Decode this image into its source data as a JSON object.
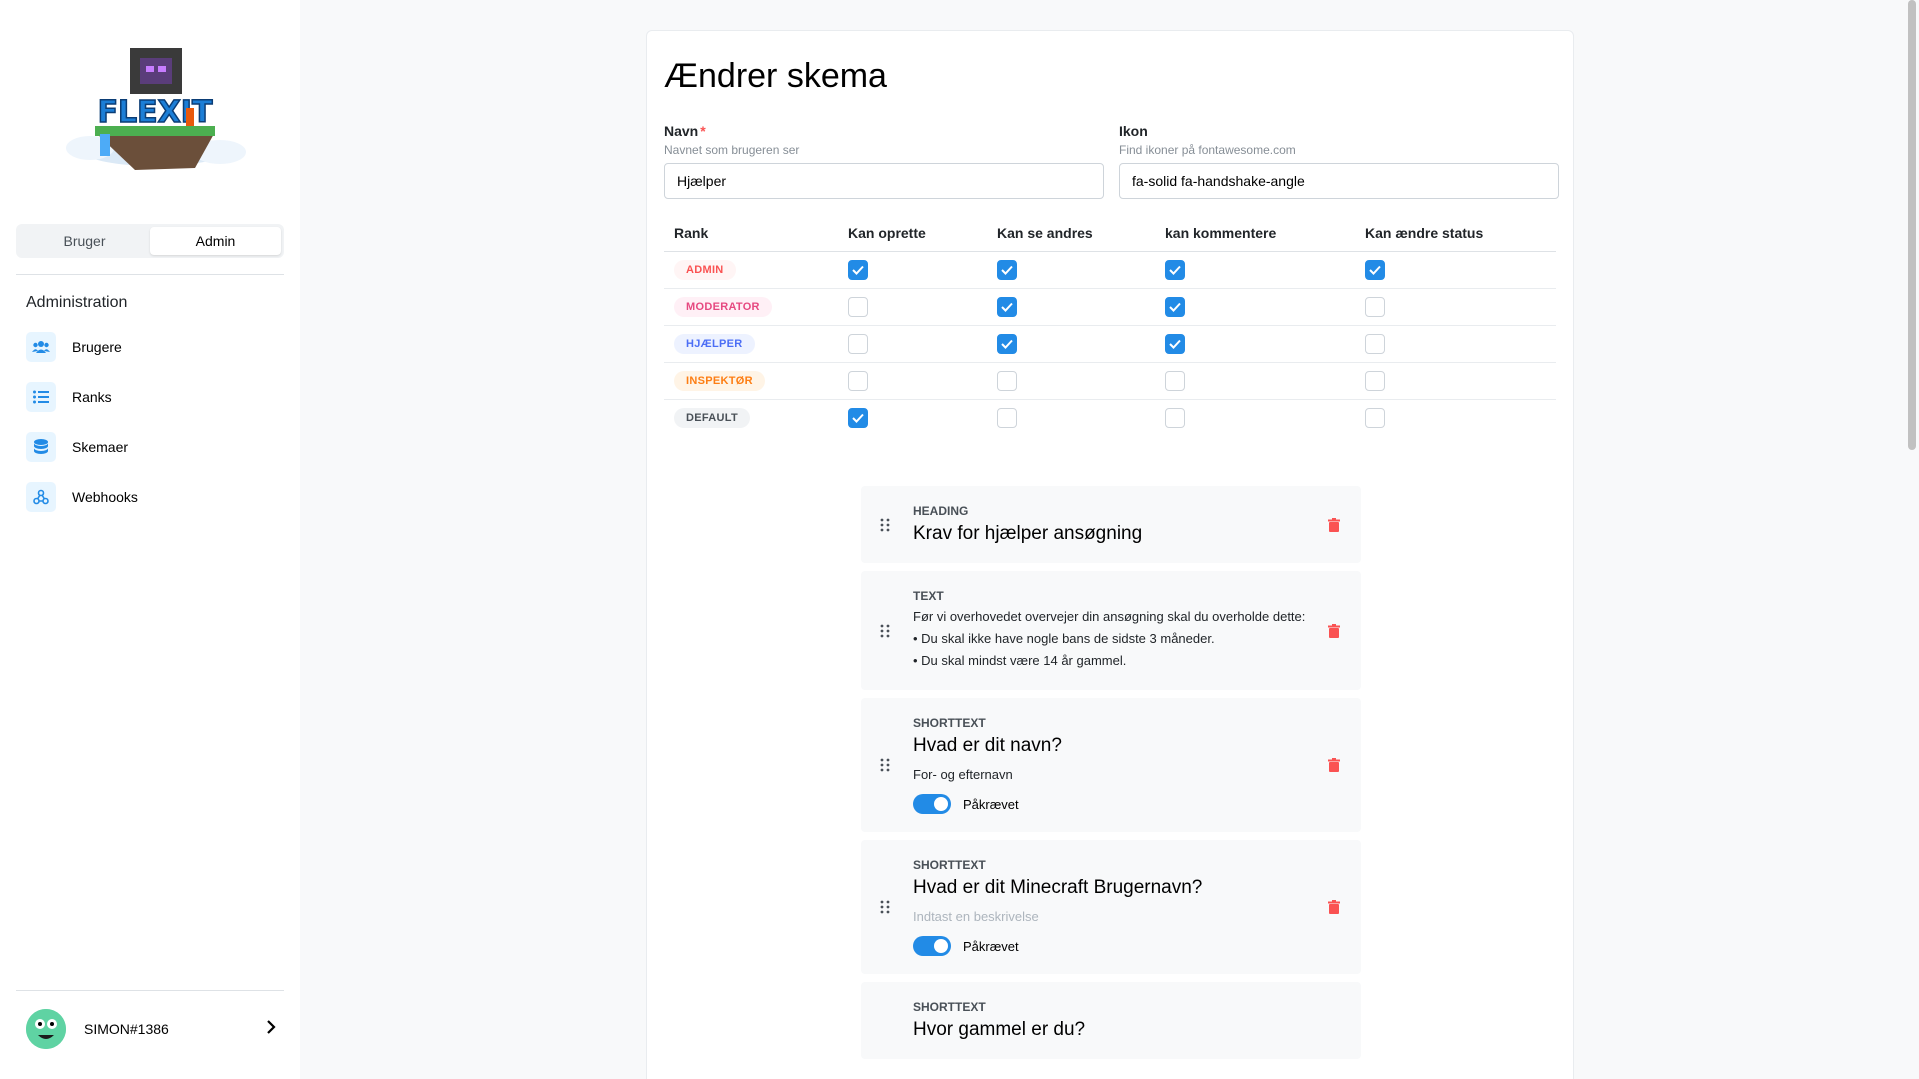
{
  "sidebar": {
    "logo_text": "FLEXIT",
    "segment": {
      "user": "Bruger",
      "admin": "Admin"
    },
    "section_title": "Administration",
    "nav": [
      {
        "label": "Brugere",
        "icon": "users-icon"
      },
      {
        "label": "Ranks",
        "icon": "list-icon"
      },
      {
        "label": "Skemaer",
        "icon": "database-icon"
      },
      {
        "label": "Webhooks",
        "icon": "webhook-icon"
      }
    ],
    "user": {
      "name": "SIMON#1386"
    }
  },
  "form": {
    "title": "Ændrer skema",
    "name_field": {
      "label": "Navn",
      "required_mark": "*",
      "description": "Navnet som brugeren ser",
      "value": "Hjælper"
    },
    "icon_field": {
      "label": "Ikon",
      "description": "Find ikoner på fontawesome.com",
      "value": "fa-solid fa-handshake-angle"
    }
  },
  "permissions": {
    "headers": [
      "Rank",
      "Kan oprette",
      "Kan se andres",
      "kan kommentere",
      "Kan ændre status"
    ],
    "rows": [
      {
        "rank": "ADMIN",
        "color": "#fa5252",
        "bg": "#fff5f5",
        "checks": [
          true,
          true,
          true,
          true
        ]
      },
      {
        "rank": "MODERATOR",
        "color": "#e64980",
        "bg": "#fff0f6",
        "checks": [
          false,
          true,
          true,
          false
        ]
      },
      {
        "rank": "HJÆLPER",
        "color": "#4c6ef5",
        "bg": "#edf2ff",
        "checks": [
          false,
          true,
          true,
          false
        ]
      },
      {
        "rank": "INSPEKTØR",
        "color": "#fd7e14",
        "bg": "#fff4e6",
        "checks": [
          false,
          false,
          false,
          false
        ]
      },
      {
        "rank": "DEFAULT",
        "color": "#495057",
        "bg": "#f1f3f5",
        "checks": [
          true,
          false,
          false,
          false
        ]
      }
    ]
  },
  "items": [
    {
      "type": "HEADING",
      "title": "Krav for hjælper ansøgning"
    },
    {
      "type": "TEXT",
      "lines": [
        "Før vi overhovedet overvejer din ansøgning skal du overholde dette:",
        "• Du skal ikke have nogle bans de sidste 3 måneder.",
        "• Du skal mindst være 14 år gammel."
      ]
    },
    {
      "type": "SHORTTEXT",
      "title": "Hvad er dit navn?",
      "description": "For- og efternavn",
      "required_label": "Påkrævet"
    },
    {
      "type": "SHORTTEXT",
      "title": "Hvad er dit Minecraft Brugernavn?",
      "description_placeholder": "Indtast en beskrivelse",
      "required_label": "Påkrævet"
    },
    {
      "type": "SHORTTEXT",
      "title": "Hvor gammel er du?"
    }
  ],
  "colors": {
    "accent": "#228be6",
    "danger": "#fa5252"
  }
}
